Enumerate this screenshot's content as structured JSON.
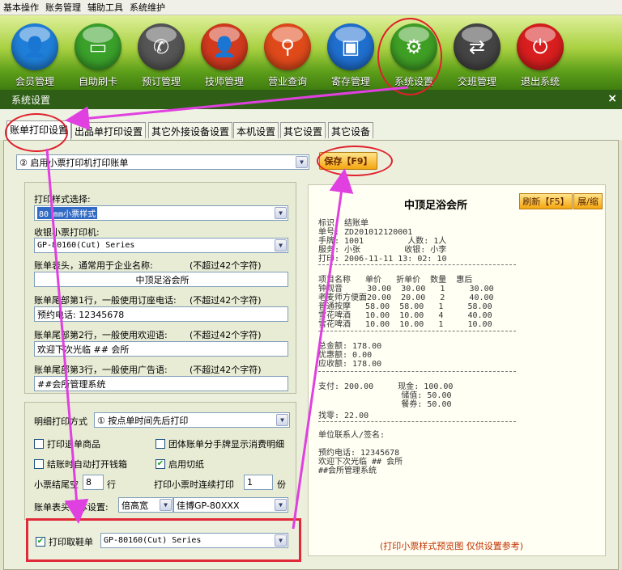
{
  "menubar": {
    "items": [
      "基本操作",
      "账务管理",
      "辅助工具",
      "系统维护"
    ]
  },
  "toolbar": {
    "items": [
      {
        "label": "会员管理",
        "icon": "member-icon",
        "color": "#1f7fd8",
        "glyph": "👤"
      },
      {
        "label": "自助刷卡",
        "icon": "card-icon",
        "color": "#3aa12a",
        "glyph": "▭"
      },
      {
        "label": "预订管理",
        "icon": "phone-icon",
        "color": "#555555",
        "glyph": "✆"
      },
      {
        "label": "技师管理",
        "icon": "technician-icon",
        "color": "#d23a1e",
        "glyph": "👤"
      },
      {
        "label": "营业查询",
        "icon": "search-icon",
        "color": "#e04a1a",
        "glyph": "⚲"
      },
      {
        "label": "寄存管理",
        "icon": "bag-icon",
        "color": "#1f6fcf",
        "glyph": "▣"
      },
      {
        "label": "系统设置",
        "icon": "gear-icon",
        "color": "#3f9f25",
        "glyph": "⚙"
      },
      {
        "label": "交班管理",
        "icon": "handover-icon",
        "color": "#444444",
        "glyph": "⇄"
      },
      {
        "label": "退出系统",
        "icon": "power-icon",
        "color": "#d81e1e",
        "glyph": "⏻"
      }
    ]
  },
  "window": {
    "title": "系统设置",
    "close": "×"
  },
  "tabs": [
    "账单打印设置",
    "出品单打印设置",
    "其它外接设备设置",
    "本机设置",
    "其它设置",
    "其它设备"
  ],
  "main": {
    "mode_select": "② 启用小票打印机打印账单",
    "save_button": "保存【F9】",
    "style_label": "打印样式选择:",
    "style_value": "80  mm小票样式",
    "printer_label": "收银小票打印机:",
    "printer_value": "GP-80160(Cut) Series",
    "header_label": "账单表头，通常用于企业名称:",
    "header_hint": "(不超过42个字符)",
    "header_value": "中顶足浴会所",
    "footer1_label": "账单尾部第1行，一般使用订座电话:",
    "footer1_hint": "(不超过42个字符)",
    "footer1_value": "预约电话: 12345678",
    "footer2_label": "账单尾部第2行，一般使用欢迎语:",
    "footer2_hint": "(不超过42个字符)",
    "footer2_value": "欢迎下次光临 ## 会所",
    "footer3_label": "账单尾部第3行，一般使用广告语:",
    "footer3_hint": "(不超过42个字符)",
    "footer3_value": "##会所管理系统",
    "detail_label": "明细打印方式",
    "detail_value": "① 按点单时间先后打印",
    "opt_return": "打印退单商品",
    "opt_group": "团体账单分手牌显示消费明细",
    "opt_cashbox": "结账时自动打开钱箱",
    "opt_cut": "启用切纸",
    "tail_blank_label": "小票结尾空",
    "tail_blank_value": "8",
    "tail_blank_unit": "行",
    "copies_label": "打印小票时连续打印",
    "copies_value": "1",
    "copies_unit": "份",
    "font_label": "账单表头字体设置:",
    "font_size": "倍高宽",
    "font_face": "佳博GP-80XXX",
    "shoe_label": "打印取鞋单",
    "shoe_printer": "GP-80160(Cut) Series"
  },
  "preview": {
    "title": "中顶足浴会所",
    "refresh": "刷新【F5】",
    "expand": "展/缩",
    "lines_top": [
      "标识: 结账单",
      "单号: ZD201012120001",
      "手牌: 1001         人数: 1人",
      "服务: 小张         收银: 小李",
      "打印: 2006-11-11 13: 02: 10"
    ],
    "lines_items": [
      "项目名称   单价   折单价  数量  惠后",
      "钟观音     30.00  30.00   1     30.00",
      "老麦师方便面20.00  20.00   2     40.00",
      "普通按摩   58.00  58.00   1     58.00",
      "雪花啤酒   10.00  10.00   4     40.00",
      "雪花啤酒   10.00  10.00   1     10.00"
    ],
    "lines_totals": [
      "总金额: 178.00",
      "优惠额: 0.00",
      "应收额: 178.00"
    ],
    "lines_pay": [
      "支付: 200.00     现金: 100.00",
      "                 储值: 50.00",
      "                 餐券: 50.00",
      "找零: 22.00"
    ],
    "signature": "单位联系人/签名:",
    "lines_footer": [
      "预约电话: 12345678",
      "欢迎下次光临 ## 会所",
      "##会所管理系统"
    ],
    "note": "(打印小票样式预览图 仅供设置参考)"
  }
}
